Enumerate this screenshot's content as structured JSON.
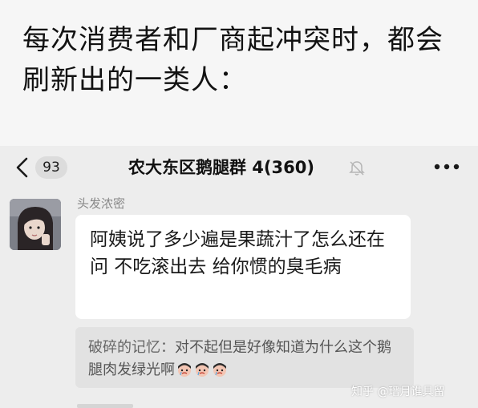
{
  "caption": "每次消费者和厂商起冲突时，都会刷新出的一类人：",
  "chat": {
    "unread_count": "93",
    "group_title": "农大东区鹅腿群 4(360)",
    "message": {
      "sender": "头发浓密",
      "text": "阿姨说了多少遍是果蔬汁了怎么还在问 不吃滚出去 给你惯的臭毛病"
    },
    "quote": {
      "author": "破碎的记忆：",
      "text": "对不起但是好像知道为什么这个鹅腿肉发绿光啊"
    }
  },
  "watermark": "知乎 @瑨月谁具留",
  "colors": {
    "chat_bg": "#ededed",
    "bubble_bg": "#ffffff",
    "quote_bg": "#e2e2e2"
  },
  "icons": {
    "back": "chevron-left-icon",
    "mute": "bell-muted-icon",
    "more": "more-dots-icon",
    "emoji": "crying-face-emoji-icon"
  }
}
